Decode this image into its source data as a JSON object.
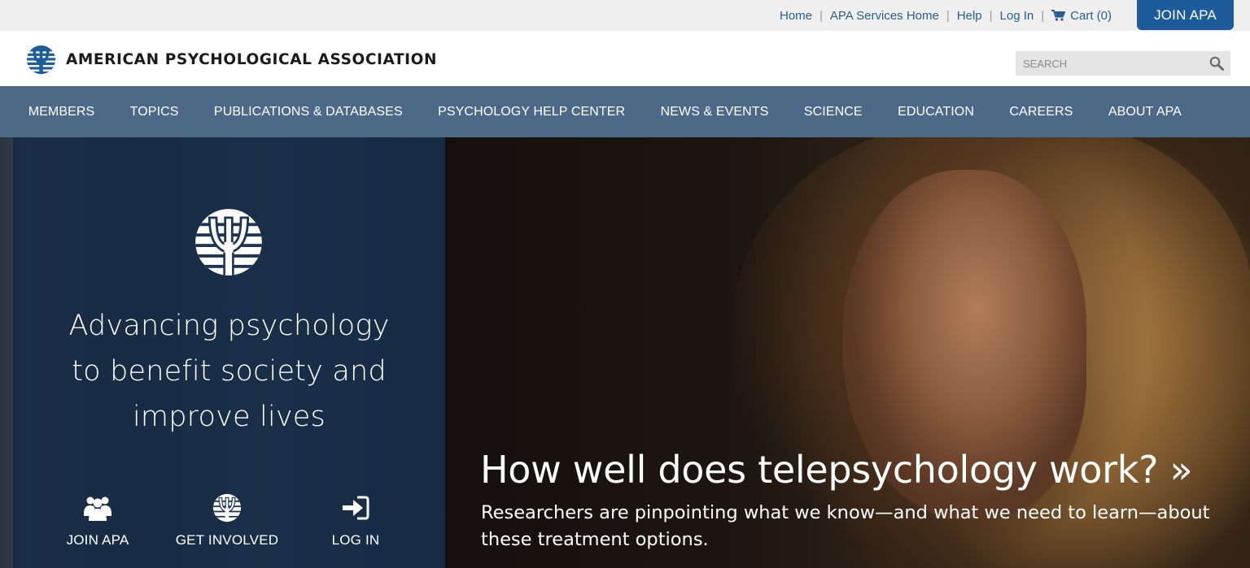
{
  "utility": {
    "links": [
      "Home",
      "APA Services Home",
      "Help",
      "Log In"
    ],
    "cart_label": "Cart (0)",
    "join_label": "JOIN APA"
  },
  "header": {
    "logo_text": "AMERICAN PSYCHOLOGICAL ASSOCIATION",
    "search_placeholder": "SEARCH"
  },
  "nav": {
    "items": [
      "MEMBERS",
      "TOPICS",
      "PUBLICATIONS & DATABASES",
      "PSYCHOLOGY HELP CENTER",
      "NEWS & EVENTS",
      "SCIENCE",
      "EDUCATION",
      "CAREERS",
      "ABOUT APA"
    ]
  },
  "hero": {
    "tagline": [
      "Advancing psychology",
      "to benefit society and",
      "improve lives"
    ],
    "actions": [
      {
        "label": "JOIN APA",
        "icon": "users-icon"
      },
      {
        "label": "GET INVOLVED",
        "icon": "apa-logo-icon"
      },
      {
        "label": "LOG IN",
        "icon": "sign-in-icon"
      }
    ],
    "headline": "How well does telepsychology work? »",
    "subtext": "Researchers are pinpointing what we know—and what we need to learn—about these treatment options."
  },
  "colors": {
    "link": "#2b5d8c",
    "join_button": "#1e5b9b",
    "nav_bg": "#4c6a87",
    "panel_bg": "#12284299"
  }
}
